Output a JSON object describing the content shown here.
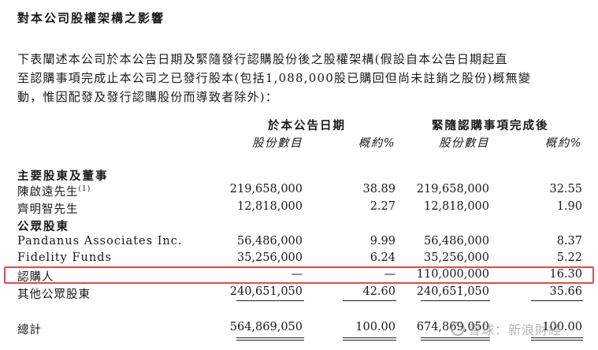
{
  "title": "對本公司股權架構之影響",
  "paragraph": [
    "下表闡述本公司於本公告日期及緊隨發行認購股份後之股權架構(假設自本公告日期起直",
    "至認購事項完成止本公司之已發行股本(包括1,088,000股已購回但尚未註銷之股份)概無變",
    "動，惟因配發及發行認購股份而導致者除外)："
  ],
  "headers": {
    "group1": "於本公告日期",
    "group2": "緊隨認購事項完成後",
    "shares": "股份數目",
    "percent": "概約%"
  },
  "sections": {
    "major": "主要股東及董事",
    "public": "公眾股東"
  },
  "rows": [
    {
      "label": "陳啟遠先生",
      "note": "(1)",
      "shares1": "219,658,000",
      "pct1": "38.89",
      "shares2": "219,658,000",
      "pct2": "32.55"
    },
    {
      "label": "齊明智先生",
      "note": "",
      "shares1": "12,818,000",
      "pct1": "2.27",
      "shares2": "12,818,000",
      "pct2": "1.90"
    },
    {
      "label": "Pandanus Associates Inc.",
      "note": "",
      "shares1": "56,486,000",
      "pct1": "9.99",
      "shares2": "56,486,000",
      "pct2": "8.37"
    },
    {
      "label": "Fidelity Funds",
      "note": "",
      "shares1": "35,256,000",
      "pct1": "6.24",
      "shares2": "35,256,000",
      "pct2": "5.22"
    },
    {
      "label": "認購人",
      "note": "",
      "shares1": "—",
      "pct1": "—",
      "shares2": "110,000,000",
      "pct2": "16.30"
    },
    {
      "label": "其他公眾股東",
      "note": "",
      "shares1": "240,651,050",
      "pct1": "42.60",
      "shares2": "240,651,050",
      "pct2": "35.66"
    }
  ],
  "total": {
    "label": "總計",
    "shares1": "564,869,050",
    "pct1": "100.00",
    "shares2": "674,869,050",
    "pct2": "100.00"
  },
  "watermark": "雪球：新浪財經",
  "colors": {
    "highlight": "#e0484c",
    "text": "#1a1a1a"
  }
}
